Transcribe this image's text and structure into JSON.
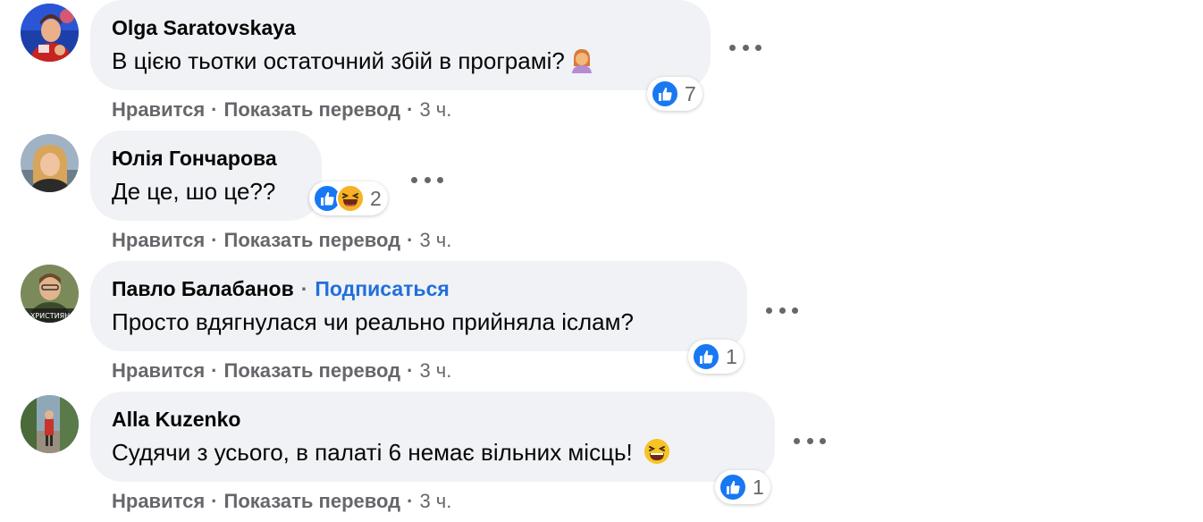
{
  "comments": [
    {
      "author": "Olga Saratovskaya",
      "text": "В цією тьотки остаточний збій в програмі?",
      "inline_emoji": "woman-facepalming-icon",
      "reactions": [
        "like-icon"
      ],
      "reaction_count": "7",
      "like_label": "Нравится",
      "translate_label": "Показать перевод",
      "time": "3 ч."
    },
    {
      "author": "Юлія Гончарова",
      "text": "Де це, шо це??",
      "reactions": [
        "like-icon",
        "haha-icon"
      ],
      "reaction_count": "2",
      "like_label": "Нравится",
      "translate_label": "Показать перевод",
      "time": "3 ч."
    },
    {
      "author": "Павло Балабанов",
      "follow_label": "Подписаться",
      "avatar_caption": "ХРИСТИЯН",
      "text": "Просто вдягнулася чи реально прийняла іслам?",
      "reactions": [
        "like-icon"
      ],
      "reaction_count": "1",
      "like_label": "Нравится",
      "translate_label": "Показать перевод",
      "time": "3 ч."
    },
    {
      "author": "Alla Kuzenko",
      "text": "Судячи з усього, в палаті 6 немає вільних місць!",
      "inline_emoji": "grinning-squinting-icon",
      "reactions": [
        "like-icon"
      ],
      "reaction_count": "1",
      "like_label": "Нравится",
      "translate_label": "Показать перевод",
      "time": "3 ч."
    }
  ],
  "separator": "·",
  "colors": {
    "bubble": "#f0f2f5",
    "secondary_text": "#65676b",
    "link": "#216fdb",
    "like_blue": "#1877f2",
    "haha_yellow": "#f7b125"
  }
}
